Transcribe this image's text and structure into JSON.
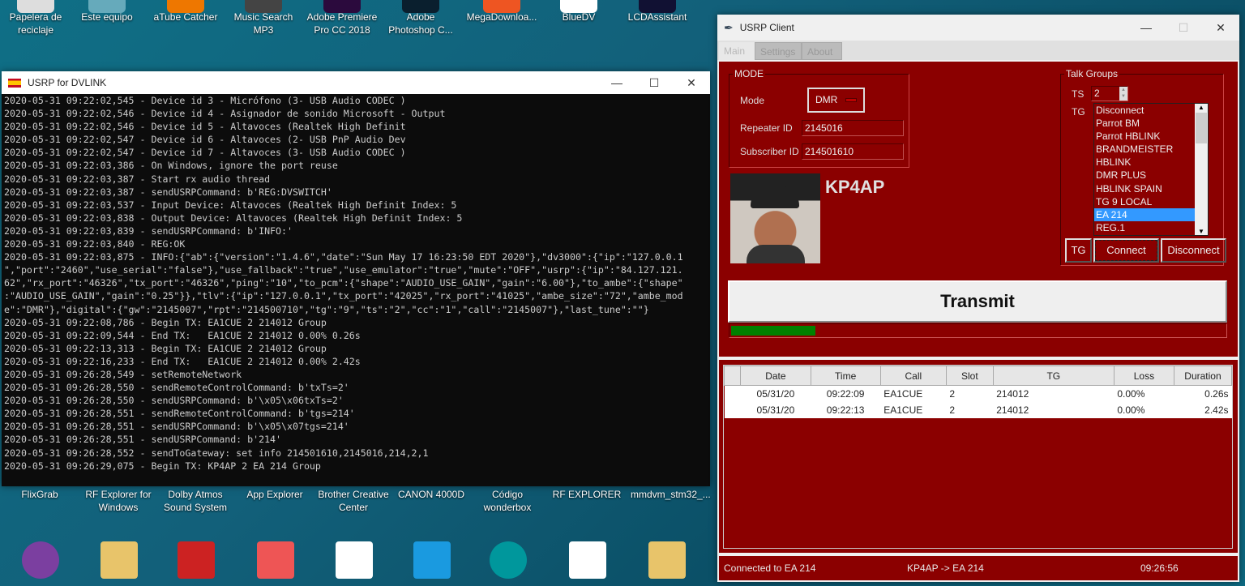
{
  "desktop": {
    "top_icons": [
      "Papelera de reciclaje",
      "Este equipo",
      "aTube Catcher",
      "Music Search MP3",
      "Adobe Premiere Pro CC 2018",
      "Adobe Photoshop C...",
      "MegaDownloa...",
      "BlueDV",
      "LCDAssistant"
    ],
    "bottom_icons": [
      "FlixGrab",
      "RF Explorer for Windows",
      "Dolby Atmos Sound System",
      "App Explorer",
      "Brother Creative Center",
      "CANON 4000D",
      "Código wonderbox",
      "RF EXPLORER",
      "mmdvm_stm32_..."
    ]
  },
  "console": {
    "title": "USRP for DVLINK",
    "lines": [
      "2020-05-31 09:22:02,545 - Device id 3 - Micrófono (3- USB Audio CODEC )",
      "2020-05-31 09:22:02,546 - Device id 4 - Asignador de sonido Microsoft - Output",
      "2020-05-31 09:22:02,546 - Device id 5 - Altavoces (Realtek High Definit",
      "2020-05-31 09:22:02,547 - Device id 6 - Altavoces (2- USB PnP Audio Dev",
      "2020-05-31 09:22:02,547 - Device id 7 - Altavoces (3- USB Audio CODEC )",
      "2020-05-31 09:22:03,386 - On Windows, ignore the port reuse",
      "2020-05-31 09:22:03,387 - Start rx audio thread",
      "2020-05-31 09:22:03,387 - sendUSRPCommand: b'REG:DVSWITCH'",
      "2020-05-31 09:22:03,537 - Input Device: Altavoces (Realtek High Definit Index: 5",
      "2020-05-31 09:22:03,838 - Output Device: Altavoces (Realtek High Definit Index: 5",
      "2020-05-31 09:22:03,839 - sendUSRPCommand: b'INFO:'",
      "2020-05-31 09:22:03,840 - REG:OK",
      "2020-05-31 09:22:03,875 - INFO:{\"ab\":{\"version\":\"1.4.6\",\"date\":\"Sun May 17 16:23:50 EDT 2020\"},\"dv3000\":{\"ip\":\"127.0.0.1",
      "\",\"port\":\"2460\",\"use_serial\":\"false\"},\"use_fallback\":\"true\",\"use_emulator\":\"true\",\"mute\":\"OFF\",\"usrp\":{\"ip\":\"84.127.121.",
      "62\",\"rx_port\":\"46326\",\"tx_port\":\"46326\",\"ping\":\"10\",\"to_pcm\":{\"shape\":\"AUDIO_USE_GAIN\",\"gain\":\"6.00\"},\"to_ambe\":{\"shape\"",
      ":\"AUDIO_USE_GAIN\",\"gain\":\"0.25\"}},\"tlv\":{\"ip\":\"127.0.0.1\",\"tx_port\":\"42025\",\"rx_port\":\"41025\",\"ambe_size\":\"72\",\"ambe_mod",
      "e\":\"DMR\"},\"digital\":{\"gw\":\"2145007\",\"rpt\":\"214500710\",\"tg\":\"9\",\"ts\":\"2\",\"cc\":\"1\",\"call\":\"2145007\"},\"last_tune\":\"\"}",
      "2020-05-31 09:22:08,786 - Begin TX: EA1CUE 2 214012 Group",
      "2020-05-31 09:22:09,544 - End TX:   EA1CUE 2 214012 0.00% 0.26s",
      "2020-05-31 09:22:13,313 - Begin TX: EA1CUE 2 214012 Group",
      "2020-05-31 09:22:16,233 - End TX:   EA1CUE 2 214012 0.00% 2.42s",
      "2020-05-31 09:26:28,549 - setRemoteNetwork",
      "2020-05-31 09:26:28,550 - sendRemoteControlCommand: b'txTs=2'",
      "2020-05-31 09:26:28,550 - sendUSRPCommand: b'\\x05\\x06txTs=2'",
      "2020-05-31 09:26:28,551 - sendRemoteControlCommand: b'tgs=214'",
      "2020-05-31 09:26:28,551 - sendUSRPCommand: b'\\x05\\x07tgs=214'",
      "2020-05-31 09:26:28,551 - sendUSRPCommand: b'214'",
      "2020-05-31 09:26:28,552 - sendToGateway: set info 214501610,2145016,214,2,1",
      "2020-05-31 09:26:29,075 - Begin TX: KP4AP 2 EA 214 Group"
    ]
  },
  "usrp": {
    "title": "USRP Client",
    "tabs": [
      "Main",
      "Settings",
      "About"
    ],
    "mode": {
      "legend": "MODE",
      "mode_label": "Mode",
      "mode_value": "DMR",
      "repeater_label": "Repeater ID",
      "repeater_value": "2145016",
      "subscriber_label": "Subscriber ID",
      "subscriber_value": "214501610"
    },
    "callsign": "KP4AP",
    "talk_groups": {
      "legend": "Talk Groups",
      "ts_label": "TS",
      "ts_value": "2",
      "tg_label": "TG",
      "items": [
        "Disconnect",
        "Parrot BM",
        "Parrot HBLINK",
        "BRANDMEISTER",
        "HBLINK",
        "DMR PLUS",
        "HBLINK SPAIN",
        "TG 9 LOCAL",
        "EA 214",
        "REG.1"
      ],
      "selected": "EA 214",
      "tg_button": "TG",
      "connect_button": "Connect",
      "disconnect_button": "Disconnect"
    },
    "transmit_label": "Transmit",
    "level_percent": 17,
    "columns": [
      "",
      "Date",
      "Time",
      "Call",
      "Slot",
      "TG",
      "Loss",
      "Duration"
    ],
    "rows": [
      [
        "",
        "05/31/20",
        "09:22:09",
        "EA1CUE",
        "2",
        "214012",
        "0.00%",
        "0.26s"
      ],
      [
        "",
        "05/31/20",
        "09:22:13",
        "EA1CUE",
        "2",
        "214012",
        "0.00%",
        "2.42s"
      ]
    ],
    "status": {
      "left": "Connected to EA 214",
      "center": "KP4AP -> EA 214",
      "right": "09:26:56"
    },
    "colors": {
      "background": "#8b0000",
      "selection": "#3399ff",
      "level": "#008000"
    }
  }
}
